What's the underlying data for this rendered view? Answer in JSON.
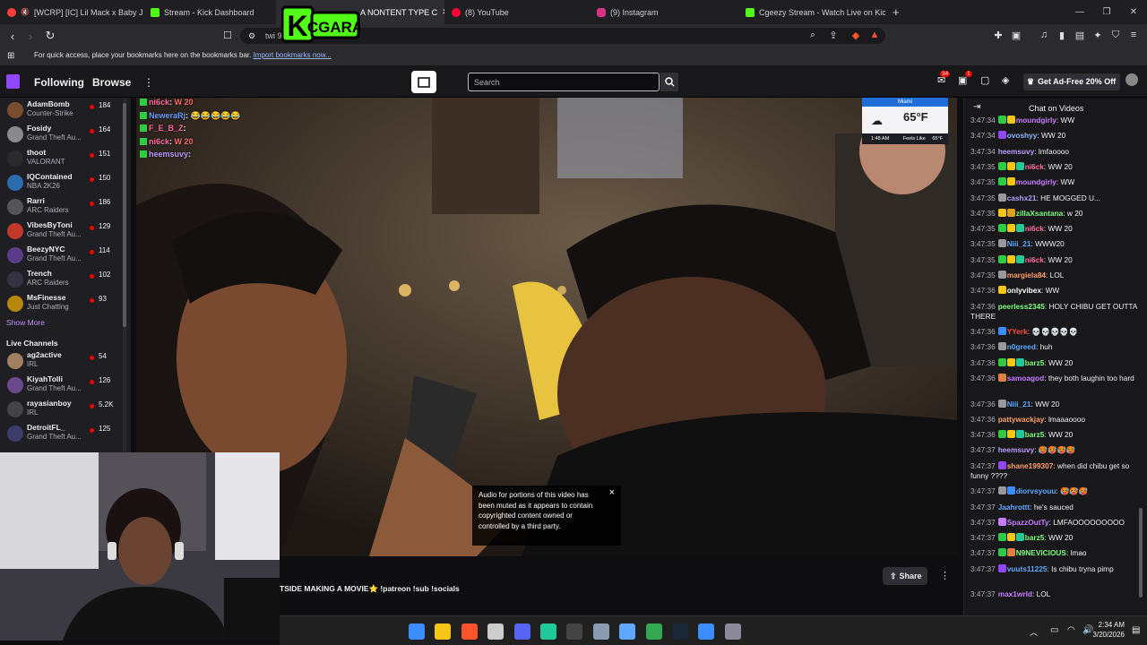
{
  "browser": {
    "tabs": [
      {
        "label": "[WCRP] [IC] Lil Mack x Baby Jack...",
        "color": "#ff3b3b"
      },
      {
        "label": "Stream - Kick Dashboard",
        "color": "#53fc18"
      },
      {
        "label": "A NONTENT TYPE C",
        "color": "#888888"
      },
      {
        "label": "(8) YouTube",
        "color": "#ff0033"
      },
      {
        "label": "(9) Instagram",
        "color": "#d63384"
      },
      {
        "label": "Cgeezy Stream - Watch Live on Kick",
        "color": "#53fc18"
      }
    ],
    "new_tab": "+",
    "url": "twi                                  989",
    "bookmarks_text": "For quick access, place your bookmarks here on the bookmarks bar.",
    "bookmarks_link": "Import bookmarks now...",
    "overlay_logo": "K CGARA"
  },
  "twitch": {
    "following": "Following",
    "browse": "Browse",
    "more": "⋮",
    "search_placeholder": "Search",
    "notif_count_1": "34",
    "notif_count_2": "1",
    "ad_free": "Get Ad-Free 20% Off"
  },
  "sidebar": {
    "channels": [
      {
        "name": "AdamBomb",
        "game": "Counter-Strike",
        "viewers": "184",
        "color": "#7a4d2e"
      },
      {
        "name": "Fosidy",
        "game": "Grand Theft Au...",
        "viewers": "164",
        "color": "#8a8a8a"
      },
      {
        "name": "thoot",
        "game": "VALORANT",
        "viewers": "151",
        "color": "#2a2a2a"
      },
      {
        "name": "IQContained",
        "game": "NBA 2K26",
        "viewers": "150",
        "color": "#2b6cb0"
      },
      {
        "name": "Rarri",
        "game": "ARC Raiders",
        "viewers": "186",
        "color": "#555555"
      },
      {
        "name": "VibesByToni",
        "game": "Grand Theft Au...",
        "viewers": "129",
        "color": "#c0392b"
      },
      {
        "name": "BeezyNYC",
        "game": "Grand Theft Au...",
        "viewers": "114",
        "color": "#5a3d8a"
      },
      {
        "name": "Trench",
        "game": "ARC Raiders",
        "viewers": "102",
        "color": "#333344"
      },
      {
        "name": "MsFinesse",
        "game": "Just Chatting",
        "viewers": "93",
        "color": "#b8860b"
      }
    ],
    "show_more": "Show More",
    "live_header": "Live Channels",
    "live": [
      {
        "name": "ag2active",
        "game": "IRL",
        "viewers": "54",
        "color": "#a08060"
      },
      {
        "name": "KiyahTolli",
        "game": "Grand Theft Au...",
        "viewers": "126",
        "color": "#6b4a8c"
      },
      {
        "name": "rayasianboy",
        "game": "IRL",
        "viewers": "5.2K",
        "color": "#444444"
      },
      {
        "name": "DetroitFL_",
        "game": "Grand Theft Au...",
        "viewers": "125",
        "color": "#3d3d6b"
      }
    ]
  },
  "video_overlay": {
    "chat": [
      {
        "user": "ni6ck",
        "text": "W 20",
        "color": "#ff6b9d"
      },
      {
        "user": "NeweraRj",
        "text": "😂😂😂😂😂",
        "color": "#6b9dff"
      },
      {
        "user": "F_E_B_Z",
        "text": "",
        "color": "#ff6b9d"
      },
      {
        "user": "ni6ck",
        "text": "W 20",
        "color": "#ff6b9d"
      },
      {
        "user": "heemsuvy",
        "text": "",
        "color": "#b99bff"
      }
    ],
    "weather": {
      "city": "Miami",
      "temp": "65°F",
      "time": "1:48 AM",
      "feels_label": "Feels Like",
      "feels": "65°F"
    },
    "muted_notice": "Audio for portions of this video has been muted as it appears to contain copyrighted content owned or controlled by a third party.",
    "close": "×"
  },
  "player": {
    "title": "TSIDE MAKING A MOVIE⭐ !patreon !sub !socials",
    "share": "Share",
    "more": "⋮"
  },
  "chat": {
    "header": "Chat on Videos",
    "messages": [
      {
        "time": "3:47:34",
        "user": "moundgirly",
        "ucolor": "#c77dff",
        "text": "WW",
        "badges": [
          "#2ecc40",
          "#f5c518"
        ]
      },
      {
        "time": "3:47:34",
        "user": "ovoshyy",
        "ucolor": "#8fb3ff",
        "text": "WW 20",
        "badges": [
          "#9146ff"
        ]
      },
      {
        "time": "3:47:34",
        "user": "heemsuvy",
        "ucolor": "#b99bff",
        "text": "lmfaoooo",
        "badges": []
      },
      {
        "time": "3:47:35",
        "user": "ni6ck",
        "ucolor": "#ff6b9d",
        "text": "WW 20",
        "badges": [
          "#2ecc40",
          "#f5c518",
          "#20c997"
        ]
      },
      {
        "time": "3:47:35",
        "user": "moundgirly",
        "ucolor": "#c77dff",
        "text": "WW",
        "badges": [
          "#2ecc40",
          "#f5c518"
        ]
      },
      {
        "time": "3:47:35",
        "user": "cashx21",
        "ucolor": "#b0a0ff",
        "text": "HE MOGGED U...",
        "badges": [
          "#999999"
        ]
      },
      {
        "time": "3:47:35",
        "user": "zillaXsantana",
        "ucolor": "#7fff7f",
        "text": "w 20",
        "badges": [
          "#f5c518",
          "#e0a020"
        ]
      },
      {
        "time": "3:47:35",
        "user": "ni6ck",
        "ucolor": "#ff6b9d",
        "text": "WW 20",
        "badges": [
          "#2ecc40",
          "#f5c518",
          "#20c997"
        ]
      },
      {
        "time": "3:47:35",
        "user": "Niii_21",
        "ucolor": "#5fa8ff",
        "text": "WWW20",
        "badges": [
          "#999999"
        ]
      },
      {
        "time": "3:47:35",
        "user": "ni6ck",
        "ucolor": "#ff6b9d",
        "text": "WW 20",
        "badges": [
          "#2ecc40",
          "#f5c518",
          "#20c997"
        ]
      },
      {
        "time": "3:47:35",
        "user": "margiela84",
        "ucolor": "#ff9f6b",
        "text": "LOL",
        "badges": [
          "#999999"
        ]
      },
      {
        "time": "3:47:36",
        "user": "onlyvibex",
        "ucolor": "#ffffff",
        "text": "WW",
        "badges": [
          "#f5c518"
        ]
      },
      {
        "time": "3:47:36",
        "user": "peerless2345",
        "ucolor": "#7fff7f",
        "text": "HOLY CHIBU GET OUTTA THERE",
        "badges": []
      },
      {
        "time": "3:47:36",
        "user": "YYerk",
        "ucolor": "#ff4d4d",
        "text": "💀💀💀💀💀",
        "badges": [
          "#3c8dff"
        ]
      },
      {
        "time": "3:47:36",
        "user": "n0greed",
        "ucolor": "#5fa8ff",
        "text": "huh",
        "badges": [
          "#999999"
        ]
      },
      {
        "time": "3:47:36",
        "user": "barz5",
        "ucolor": "#7fff7f",
        "text": "WW 20",
        "badges": [
          "#2ecc40",
          "#f5c518",
          "#20c997"
        ]
      },
      {
        "time": "3:47:36",
        "user": "samoagod",
        "ucolor": "#c77dff",
        "text": "they both laughin too hard",
        "badges": [
          "#e08040"
        ]
      },
      {
        "time": "3:47:36",
        "user": "Niii_21",
        "ucolor": "#5fa8ff",
        "text": "WW 20",
        "badges": [
          "#999999"
        ]
      },
      {
        "time": "3:47:36",
        "user": "pattywackjay",
        "ucolor": "#ff9f6b",
        "text": "lmaaaoooo",
        "badges": []
      },
      {
        "time": "3:47:36",
        "user": "barz5",
        "ucolor": "#7fff7f",
        "text": "WW 20",
        "badges": [
          "#2ecc40",
          "#f5c518",
          "#20c997"
        ]
      },
      {
        "time": "3:47:37",
        "user": "heemsuvy",
        "ucolor": "#b99bff",
        "text": "🥵🥵🥵🥵",
        "badges": []
      },
      {
        "time": "3:47:37",
        "user": "shane199307",
        "ucolor": "#ff9f6b",
        "text": "when did chibu get so funny ????",
        "badges": [
          "#9146ff"
        ]
      },
      {
        "time": "3:47:37",
        "user": "diorvsyouu",
        "ucolor": "#5fa8ff",
        "text": "🥵🥵🥵",
        "badges": [
          "#999999",
          "#3c8dff"
        ]
      },
      {
        "time": "3:47:37",
        "user": "Jaahrottt",
        "ucolor": "#5fa8ff",
        "text": "he's sauced",
        "badges": []
      },
      {
        "time": "3:47:37",
        "user": "SpazzOutTy",
        "ucolor": "#c77dff",
        "text": "LMFAOOOOOOOOO",
        "badges": [
          "#c77dff"
        ]
      },
      {
        "time": "3:47:37",
        "user": "barz5",
        "ucolor": "#7fff7f",
        "text": "WW 20",
        "badges": [
          "#2ecc40",
          "#f5c518",
          "#20c997"
        ]
      },
      {
        "time": "3:47:37",
        "user": "N9NEVICIOUS",
        "ucolor": "#7fff7f",
        "text": "lmao",
        "badges": [
          "#2ecc40",
          "#e08040"
        ]
      },
      {
        "time": "3:47:37",
        "user": "vuuts11225",
        "ucolor": "#5fa8ff",
        "text": "Is chibu tryna pimp",
        "badges": [
          "#9146ff"
        ]
      },
      {
        "time": "3:47:37",
        "user": "max1wrld",
        "ucolor": "#c77dff",
        "text": "LOL",
        "badges": []
      }
    ]
  },
  "taskbar": {
    "time": "2:34 AM",
    "date": "3/20/2026",
    "apps": [
      {
        "name": "start-icon",
        "color": "#3c8dff"
      },
      {
        "name": "file-explorer-icon",
        "color": "#f5c518"
      },
      {
        "name": "brave-icon",
        "color": "#fb542b"
      },
      {
        "name": "store-icon",
        "color": "#cccccc"
      },
      {
        "name": "discord-icon",
        "color": "#5865f2"
      },
      {
        "name": "messages-icon",
        "color": "#20c997"
      },
      {
        "name": "capcut-icon",
        "color": "#444444"
      },
      {
        "name": "settings-icon",
        "color": "#8a9bb0"
      },
      {
        "name": "notepad-icon",
        "color": "#5fa8ff"
      },
      {
        "name": "chrome-icon",
        "color": "#34a853"
      },
      {
        "name": "steam-icon",
        "color": "#1b2838"
      },
      {
        "name": "remote-icon",
        "color": "#3c8dff"
      },
      {
        "name": "obs-icon",
        "color": "#8a8a9a"
      }
    ]
  }
}
